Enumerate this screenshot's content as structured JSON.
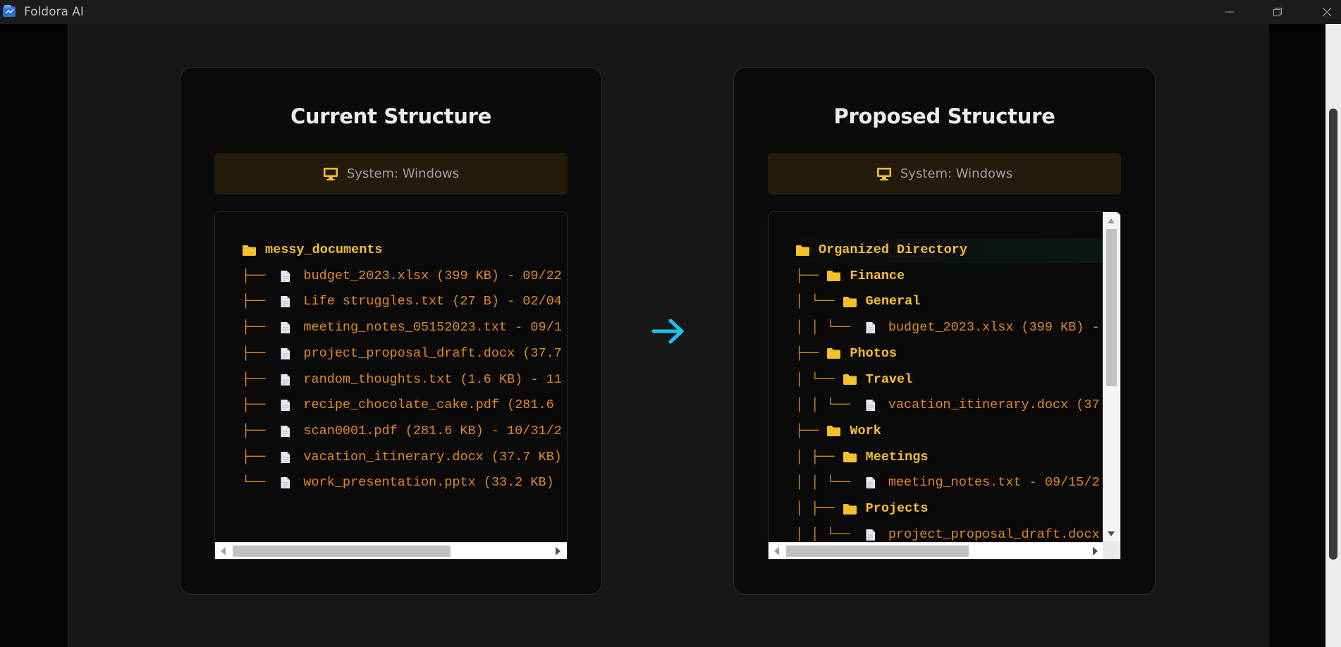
{
  "window": {
    "title": "Foldora AI"
  },
  "colors": {
    "accent_arrow": "#1ec0f0",
    "folder": "#f6c02a",
    "file_text": "#e08a1e",
    "system_box": "#231c0c"
  },
  "current": {
    "title": "Current Structure",
    "system_label": "System: Windows",
    "rows": [
      {
        "prefix": "",
        "type": "folder",
        "name": "messy_documents"
      },
      {
        "prefix": "├── ",
        "type": "file",
        "name": "budget_2023.xlsx (399 KB) - 09/22"
      },
      {
        "prefix": "├── ",
        "type": "file",
        "name": "Life struggles.txt (27 B) - 02/04"
      },
      {
        "prefix": "├── ",
        "type": "file",
        "name": "meeting_notes_05152023.txt - 09/1"
      },
      {
        "prefix": "├── ",
        "type": "file",
        "name": "project_proposal_draft.docx (37.7"
      },
      {
        "prefix": "├── ",
        "type": "file",
        "name": "random_thoughts.txt (1.6 KB) - 11"
      },
      {
        "prefix": "├── ",
        "type": "file",
        "name": "recipe_chocolate_cake.pdf (281.6 "
      },
      {
        "prefix": "├── ",
        "type": "file",
        "name": "scan0001.pdf (281.6 KB) - 10/31/2"
      },
      {
        "prefix": "├── ",
        "type": "file",
        "name": "vacation_itinerary.docx (37.7 KB)"
      },
      {
        "prefix": "└── ",
        "type": "file",
        "name": "work_presentation.pptx (33.2 KB)"
      }
    ]
  },
  "proposed": {
    "title": "Proposed Structure",
    "system_label": "System: Windows",
    "rows": [
      {
        "prefix": "",
        "type": "folder",
        "name": "Organized Directory"
      },
      {
        "prefix": "├── ",
        "type": "folder",
        "name": "Finance"
      },
      {
        "prefix": "│ └── ",
        "type": "folder",
        "name": "General"
      },
      {
        "prefix": "│ │ └── ",
        "type": "file",
        "name": "budget_2023.xlsx (399 KB) -"
      },
      {
        "prefix": "├── ",
        "type": "folder",
        "name": "Photos"
      },
      {
        "prefix": "│ └── ",
        "type": "folder",
        "name": "Travel"
      },
      {
        "prefix": "│ │ └── ",
        "type": "file",
        "name": "vacation_itinerary.docx (37"
      },
      {
        "prefix": "├── ",
        "type": "folder",
        "name": "Work"
      },
      {
        "prefix": "│ ├── ",
        "type": "folder",
        "name": "Meetings"
      },
      {
        "prefix": "│ │ └── ",
        "type": "file",
        "name": "meeting_notes.txt - 09/15/2"
      },
      {
        "prefix": "│ ├── ",
        "type": "folder",
        "name": "Projects"
      },
      {
        "prefix": "│ │ └── ",
        "type": "file",
        "name": "project_proposal_draft.docx"
      }
    ]
  }
}
